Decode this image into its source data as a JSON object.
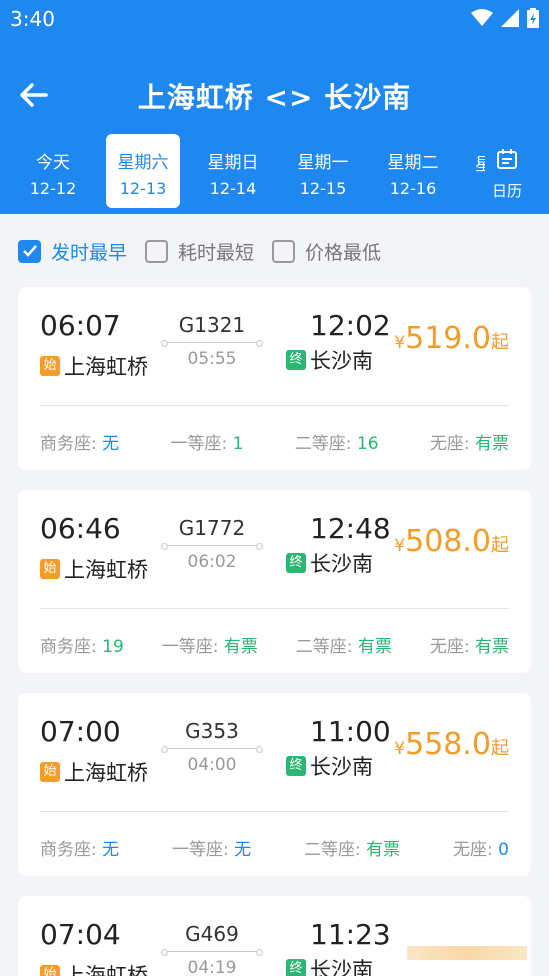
{
  "status_bar": {
    "time": "3:40"
  },
  "header": {
    "title": "上海虹桥 <> 长沙南"
  },
  "dates": [
    {
      "weekday": "今天",
      "date": "12-12"
    },
    {
      "weekday": "星期六",
      "date": "12-13"
    },
    {
      "weekday": "星期日",
      "date": "12-14"
    },
    {
      "weekday": "星期一",
      "date": "12-15"
    },
    {
      "weekday": "星期二",
      "date": "12-16"
    }
  ],
  "date_overflow_char": "星",
  "calendar_label": "日历",
  "filters": [
    {
      "label": "发时最早",
      "checked": true
    },
    {
      "label": "耗时最短",
      "checked": false
    },
    {
      "label": "价格最低",
      "checked": false
    }
  ],
  "seat_labels": {
    "business": "商务座:",
    "first": "一等座:",
    "second": "二等座:",
    "none": "无座:"
  },
  "trains": [
    {
      "dep_time": "06:07",
      "arr_time": "12:02",
      "train_no": "G1321",
      "duration": "05:55",
      "dep_tag": "始",
      "dep_station": "上海虹桥",
      "arr_tag": "终",
      "arr_station": "长沙南",
      "currency": "¥",
      "price": "519.0",
      "price_suffix": "起",
      "business": "无",
      "first": "1",
      "second": "16",
      "none": "有票"
    },
    {
      "dep_time": "06:46",
      "arr_time": "12:48",
      "train_no": "G1772",
      "duration": "06:02",
      "dep_tag": "始",
      "dep_station": "上海虹桥",
      "arr_tag": "终",
      "arr_station": "长沙南",
      "currency": "¥",
      "price": "508.0",
      "price_suffix": "起",
      "business": "19",
      "first": "有票",
      "second": "有票",
      "none": "有票"
    },
    {
      "dep_time": "07:00",
      "arr_time": "11:00",
      "train_no": "G353",
      "duration": "04:00",
      "dep_tag": "始",
      "dep_station": "上海虹桥",
      "arr_tag": "终",
      "arr_station": "长沙南",
      "currency": "¥",
      "price": "558.0",
      "price_suffix": "起",
      "business": "无",
      "first": "无",
      "second": "有票",
      "none": "0"
    },
    {
      "dep_time": "07:04",
      "arr_time": "11:23",
      "train_no": "G469",
      "duration": "04:19",
      "dep_tag": "始",
      "dep_station": "上海虹桥",
      "arr_tag": "终",
      "arr_station": "长沙南"
    }
  ],
  "colors": {
    "primary": "#1e88f0",
    "price": "#f39c2a",
    "available": "#2bb673"
  }
}
